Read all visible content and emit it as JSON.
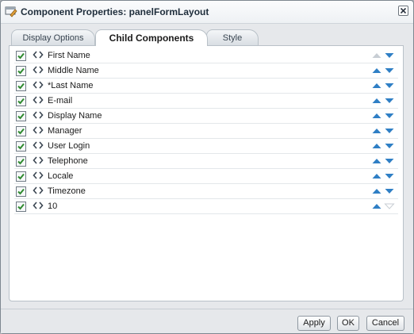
{
  "dialog": {
    "title": "Component Properties: panelFormLayout",
    "close_icon": "close-icon",
    "title_icon": "component-properties-icon"
  },
  "tabs": [
    {
      "label": "Display Options",
      "active": false
    },
    {
      "label": "Child Components",
      "active": true
    },
    {
      "label": "Style",
      "active": false
    }
  ],
  "children": [
    {
      "label": "First Name",
      "checked": true,
      "up_enabled": false,
      "down_enabled": true
    },
    {
      "label": "Middle Name",
      "checked": true,
      "up_enabled": true,
      "down_enabled": true
    },
    {
      "label": "*Last Name",
      "checked": true,
      "up_enabled": true,
      "down_enabled": true
    },
    {
      "label": "E-mail",
      "checked": true,
      "up_enabled": true,
      "down_enabled": true
    },
    {
      "label": "Display Name",
      "checked": true,
      "up_enabled": true,
      "down_enabled": true
    },
    {
      "label": "Manager",
      "checked": true,
      "up_enabled": true,
      "down_enabled": true
    },
    {
      "label": "User Login",
      "checked": true,
      "up_enabled": true,
      "down_enabled": true
    },
    {
      "label": "Telephone",
      "checked": true,
      "up_enabled": true,
      "down_enabled": true
    },
    {
      "label": "Locale",
      "checked": true,
      "up_enabled": true,
      "down_enabled": true
    },
    {
      "label": "Timezone",
      "checked": true,
      "up_enabled": true,
      "down_enabled": true
    },
    {
      "label": "10",
      "checked": true,
      "up_enabled": true,
      "down_enabled": false
    }
  ],
  "footer": {
    "apply_label": "Apply",
    "ok_label": "OK",
    "cancel_label": "Cancel"
  },
  "colors": {
    "arrow_enabled": "#2f7fc5",
    "arrow_disabled": "#c8ced4",
    "check": "#2f8a2f"
  }
}
